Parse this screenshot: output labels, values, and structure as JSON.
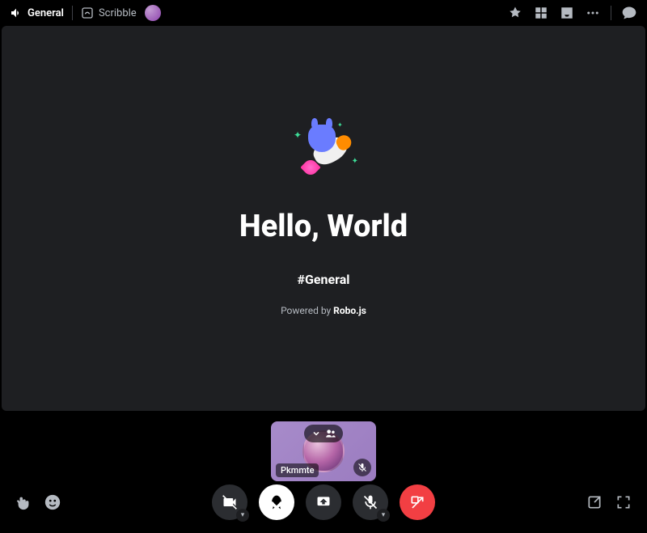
{
  "topbar": {
    "channel1": "General",
    "channel2": "Scribble"
  },
  "stage": {
    "title": "Hello, World",
    "channelTag": "#General",
    "poweredPrefix": "Powered by ",
    "poweredName": "Robo.js"
  },
  "participant": {
    "name": "Pkmmte"
  }
}
